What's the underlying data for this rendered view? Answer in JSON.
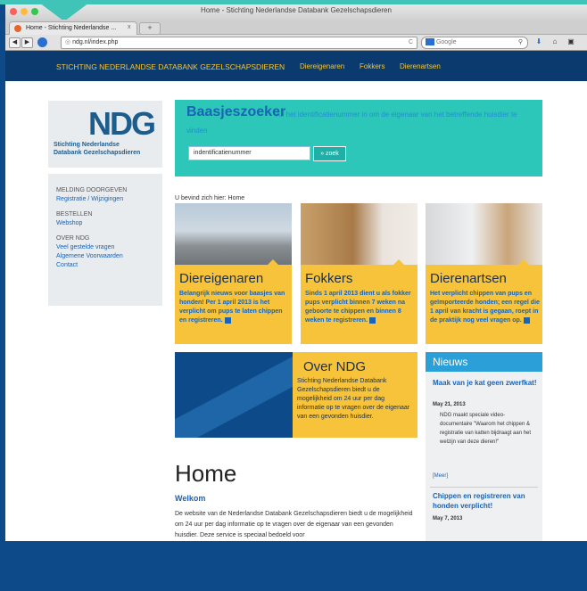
{
  "browser": {
    "window_title": "Home - Stichting Nederlandse Databank Gezelschapsdieren",
    "tab_label": "Home - Stichting Nederlandse ...",
    "tab_close": "x",
    "new_tab": "+",
    "url": "ndg.nl/index.php",
    "search_placeholder": "Google",
    "back": "◀",
    "forward": "▶",
    "reload": "C"
  },
  "site_nav": {
    "brand": "STICHTING NEDERLANDSE DATABANK GEZELSCHAPSDIEREN",
    "links": [
      "Diereigenaren",
      "Fokkers",
      "Dierenartsen"
    ]
  },
  "logo": {
    "mark": "NDG",
    "line1": "Stichting Nederlandse",
    "line2": "Databank Gezelschapsdieren"
  },
  "sidemenu": {
    "groups": [
      {
        "heading": "MELDING DOORGEVEN",
        "links": [
          "Registratie / Wijzigingen"
        ]
      },
      {
        "heading": "BESTELLEN",
        "links": [
          "Webshop"
        ]
      },
      {
        "heading": "OVER NDG",
        "links": [
          "Veel gestelde vragen",
          "Algemene Voorwaarden",
          "Contact"
        ]
      }
    ]
  },
  "search": {
    "title": "Baasjeszoeker",
    "subtitle": "Vul het identificatienummer in om de eigenaar van het betreffende huisdier te vinden",
    "input_value": "indentificatienummer",
    "button": "» zoek"
  },
  "breadcrumb": "U bevind zich hier: Home",
  "cards": [
    {
      "title": "Diereigenaren",
      "text": "Belangrijk nieuws voor baasjes van honden! Per 1 april 2013 is het verplicht om pups te laten chippen en registreren."
    },
    {
      "title": "Fokkers",
      "text": "Sinds 1 april 2013 dient u als fokker pups verplicht binnen 7 weken na geboorte te chippen en binnen 8 weken te registreren."
    },
    {
      "title": "Dierenartsen",
      "text": "Het verplicht chippen van pups en geïmporteerde honden; een regel die 1 april van kracht is gegaan, roept in de praktijk nog veel vragen op."
    }
  ],
  "over": {
    "title": "Over NDG",
    "text": "Stichting Nederlandse Databank Gezelschapsdieren biedt u de mogelijkheid om 24 uur per dag informatie op te vragen over de eigenaar van een gevonden huisdier."
  },
  "news": {
    "heading": "Nieuws",
    "items": [
      {
        "title": "Maak van je kat geen zwerfkat!",
        "date": "May 21, 2013",
        "text": "NDG maakt speciale video-documentaire \"Waarom het chippen & registratie van katten bijdraagt aan het welzijn van deze dieren!\"",
        "more": "[Meer]"
      },
      {
        "title": "Chippen en registreren van honden verplicht!",
        "date": "May 7, 2013"
      }
    ]
  },
  "home": {
    "heading": "Home",
    "welcome": "Welkom",
    "text": "De website van de Nederlandse Databank Gezelschapsdieren biedt u de mogelijkheid om 24 uur per dag informatie op te vragen over de eigenaar van een gevonden huisdier. Deze service is speciaal bedoeld voor"
  },
  "colors": {
    "accent_teal": "#2dc7b9",
    "nav_blue": "#0b3b6e",
    "card_yellow": "#f6c33a",
    "link_blue": "#1a63b5"
  }
}
